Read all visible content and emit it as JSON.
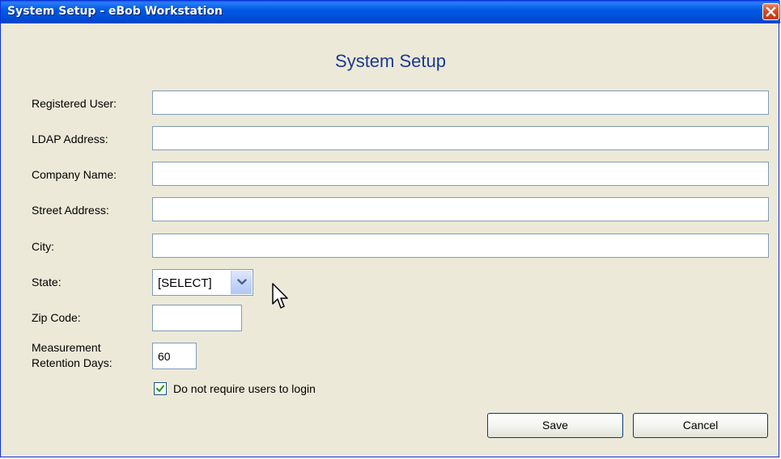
{
  "window": {
    "title": "System Setup - eBob Workstation",
    "close_icon": "close-icon",
    "titlebar_color": "#0058e6",
    "background_color": "#ece9d8"
  },
  "heading": "System Setup",
  "fields": {
    "registered_user": {
      "label": "Registered User:",
      "value": ""
    },
    "ldap_address": {
      "label": "LDAP Address:",
      "value": ""
    },
    "company_name": {
      "label": "Company Name:",
      "value": ""
    },
    "street_address": {
      "label": "Street Address:",
      "value": ""
    },
    "city": {
      "label": "City:",
      "value": ""
    },
    "state": {
      "label": "State:",
      "selected": "[SELECT]"
    },
    "zip_code": {
      "label": "Zip Code:",
      "value": ""
    },
    "retention": {
      "label_line1": "Measurement",
      "label_line2": "Retention Days:",
      "value": "60"
    }
  },
  "login_checkbox": {
    "label": "Do not require users to login",
    "checked": true
  },
  "buttons": {
    "save": "Save",
    "cancel": "Cancel"
  }
}
